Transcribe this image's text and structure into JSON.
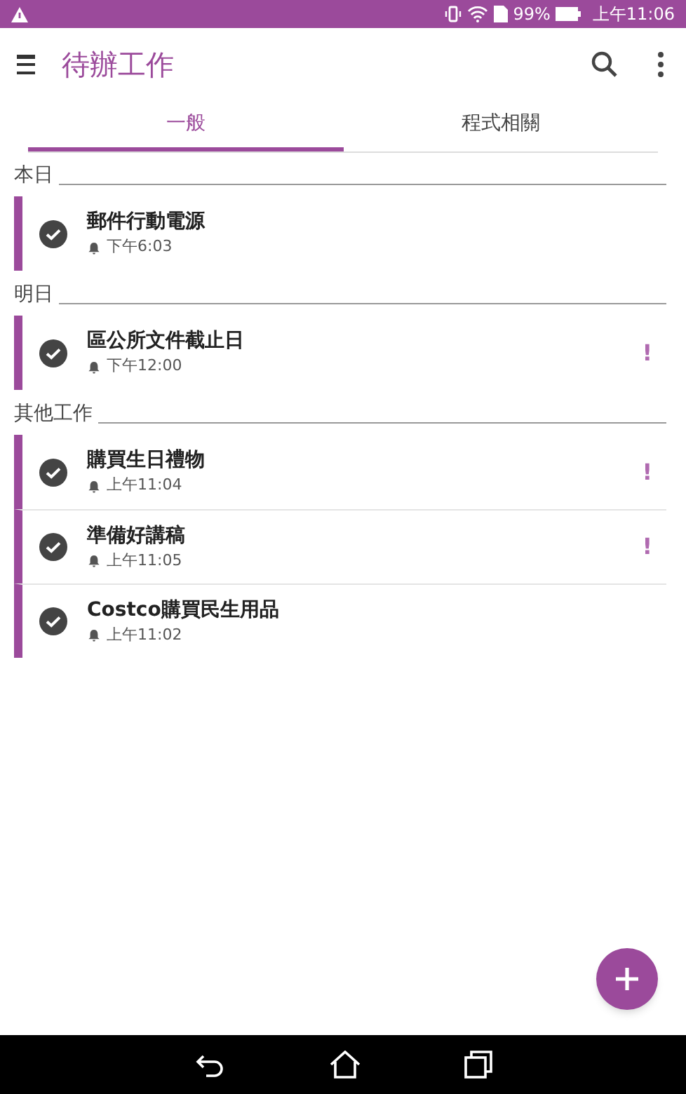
{
  "status_bar": {
    "battery": "99%",
    "time": "上午11:06"
  },
  "app_bar": {
    "title": "待辦工作"
  },
  "tabs": [
    {
      "label": "一般",
      "selected": true
    },
    {
      "label": "程式相關",
      "selected": false
    }
  ],
  "sections": [
    {
      "title": "本日",
      "tasks": [
        {
          "title": "郵件行動電源",
          "time": "下午6:03",
          "done": true
        }
      ]
    },
    {
      "title": "明日",
      "tasks": [
        {
          "title": "區公所文件截止日",
          "time": "下午12:00",
          "done": true,
          "priority": "!"
        }
      ]
    },
    {
      "title": "其他工作",
      "tasks": [
        {
          "title": "購買生日禮物",
          "time": "上午11:04",
          "done": true,
          "priority": "!"
        },
        {
          "title": "準備好講稿",
          "time": "上午11:05",
          "done": true,
          "priority": "!"
        },
        {
          "title": "Costco購買民生用品",
          "time": "上午11:02",
          "done": true
        }
      ]
    }
  ]
}
